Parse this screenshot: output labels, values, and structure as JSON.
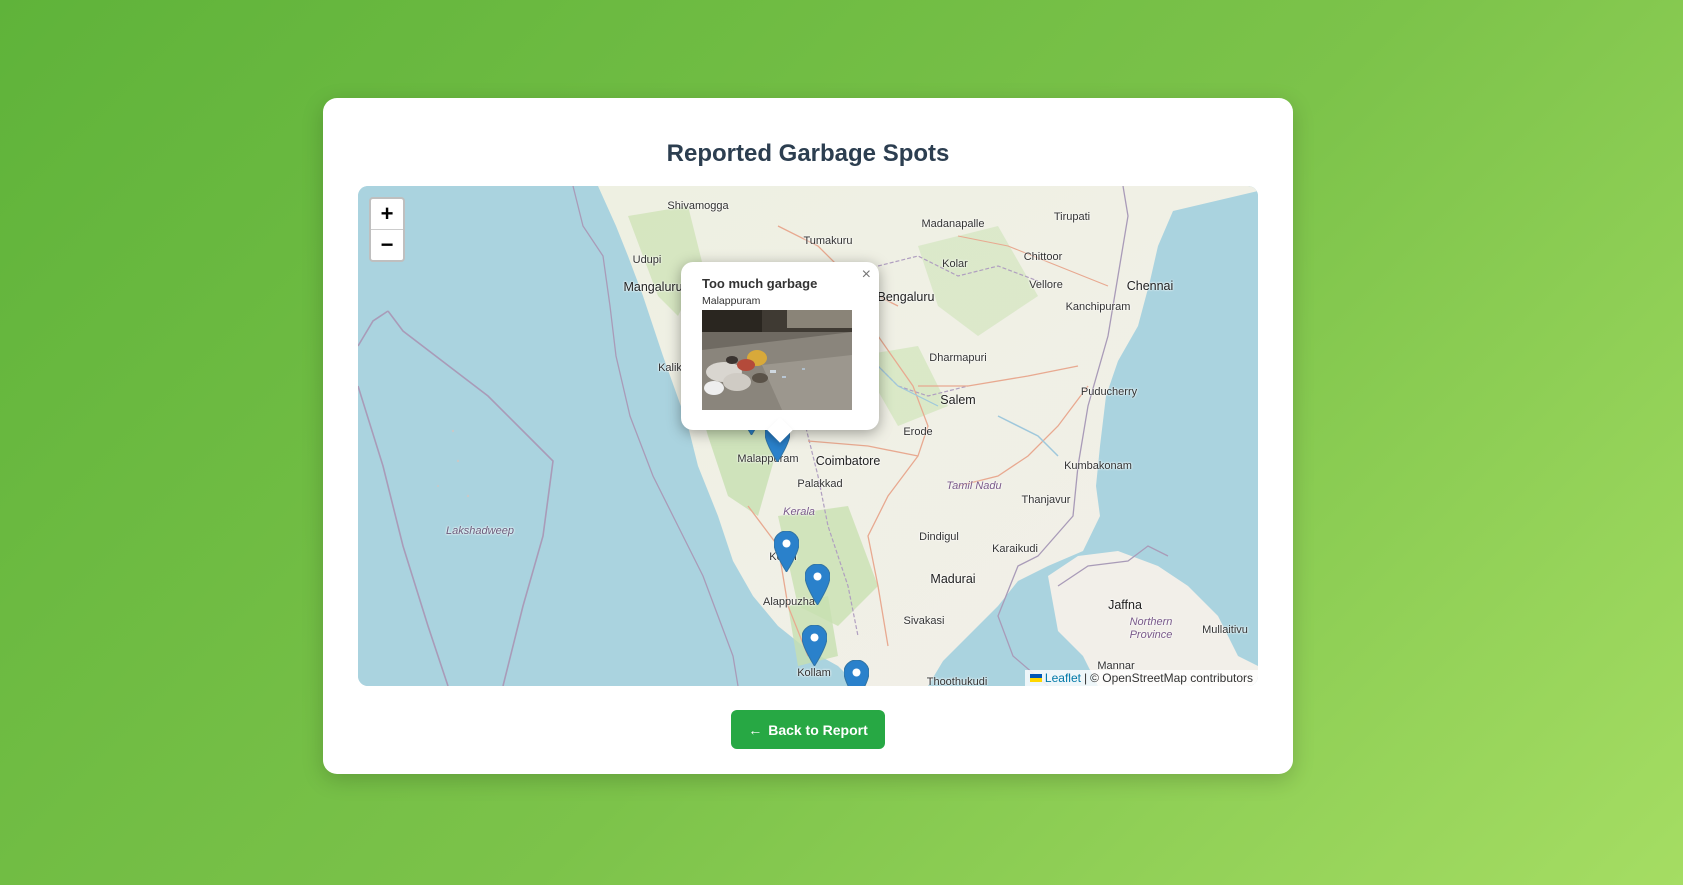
{
  "page": {
    "title": "Reported Garbage Spots"
  },
  "map": {
    "zoom_in_label": "+",
    "zoom_out_label": "−",
    "places": {
      "shivamogga": "Shivamogga",
      "tumakuru": "Tumakuru",
      "madanapalle": "Madanapalle",
      "tirupati": "Tirupati",
      "udupi": "Udupi",
      "kolar": "Kolar",
      "chittoor": "Chittoor",
      "mangaluru": "Mangaluru",
      "bengaluru": "Bengaluru",
      "vellore": "Vellore",
      "chennai": "Chennai",
      "kanchipuram": "Kanchipuram",
      "kalik": "Kalik",
      "dharmapuri": "Dharmapuri",
      "puducherry": "Puducherry",
      "salem": "Salem",
      "erode": "Erode",
      "malappuram": "Malappuram",
      "coimbatore": "Coimbatore",
      "kumbakonam": "Kumbakonam",
      "palakkad": "Palakkad",
      "tamil_nadu": "Tamil Nadu",
      "thanjavur": "Thanjavur",
      "kerala": "Kerala",
      "lakshadweep": "Lakshadweep",
      "dindigul": "Dindigul",
      "karaikudi": "Karaikudi",
      "kochi": "Kochi",
      "madurai": "Madurai",
      "jaffna": "Jaffna",
      "alappuzha": "Alappuzha",
      "northern_province": "Northern Province",
      "sivakasi": "Sivakasi",
      "mullaitivu": "Mullaitivu",
      "kollam": "Kollam",
      "mannar": "Mannar",
      "thoothukudi": "Thoothukudi"
    },
    "popup": {
      "title": "Too much garbage",
      "location": "Malappuram",
      "close_label": "×"
    },
    "attribution": {
      "leaflet_label": "Leaflet",
      "separator": "|",
      "osm_label": "© OpenStreetMap contributors"
    },
    "colors": {
      "water": "#aad3df",
      "land": "#f2efe9",
      "marker": "#2a81cb"
    }
  },
  "actions": {
    "back_icon": "←",
    "back_label": "Back to Report"
  }
}
